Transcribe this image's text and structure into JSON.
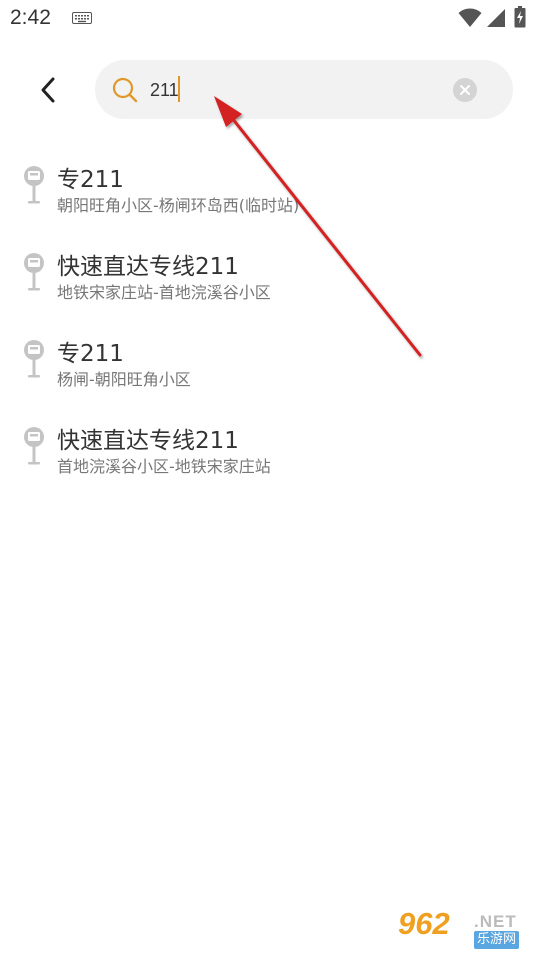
{
  "status_bar": {
    "time": "2:42",
    "icons": [
      "keyboard-icon",
      "wifi-icon",
      "cell-signal-icon",
      "battery-charging-icon"
    ]
  },
  "search": {
    "value": "211",
    "placeholder": "",
    "accent_color": "#e0982a"
  },
  "results": [
    {
      "name": "专211",
      "route": "朝阳旺角小区-杨闸环岛西(临时站)"
    },
    {
      "name": "快速直达专线211",
      "route": "地铁宋家庄站-首地浣溪谷小区"
    },
    {
      "name": "专211",
      "route": "杨闸-朝阳旺角小区"
    },
    {
      "name": "快速直达专线211",
      "route": "首地浣溪谷小区-地铁宋家庄站"
    }
  ],
  "annotation": {
    "color": "#d42020"
  },
  "watermark": {
    "main": "962",
    "net": ".NET",
    "sub": "乐游网"
  }
}
